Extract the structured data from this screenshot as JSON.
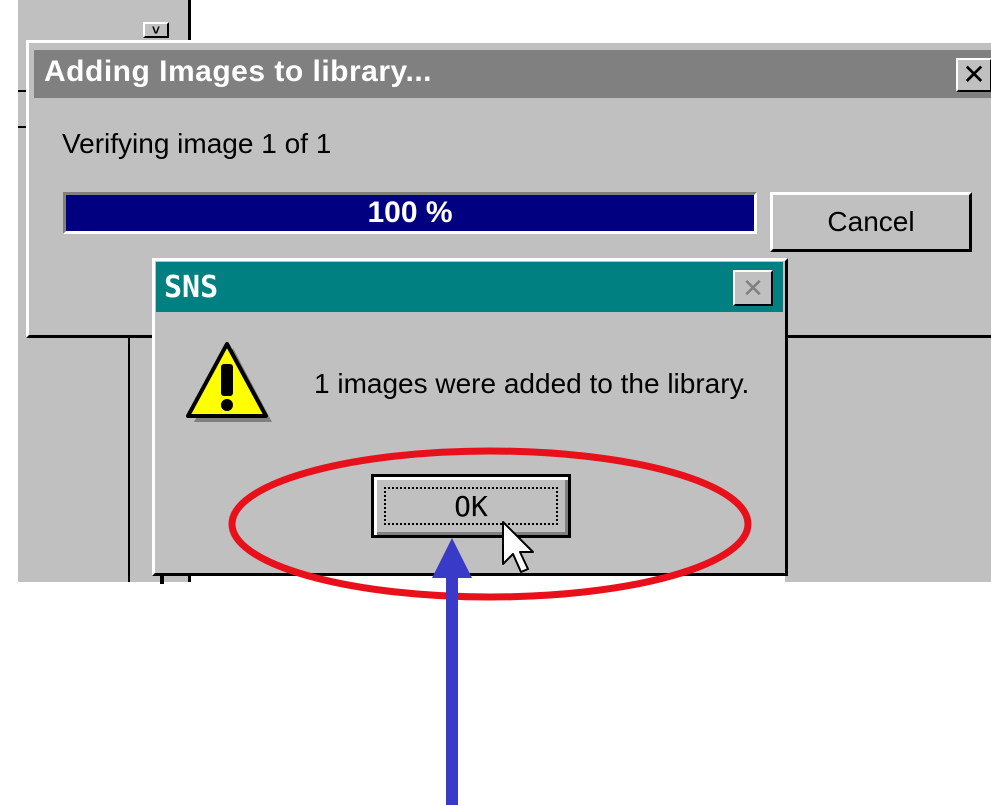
{
  "background_app": {
    "dropdown_icon": "chevron-down-icon"
  },
  "progress_dialog": {
    "title": "Adding Images to library...",
    "close_label": "✕",
    "status": "Verifying image 1 of 1",
    "progress_percent": 100,
    "progress_label": "100 %",
    "cancel_label": "Cancel",
    "colors": {
      "titlebar": "#808080",
      "bar": "#000080"
    }
  },
  "message_box": {
    "title": "SNS",
    "close_label": "✕",
    "icon": "warning-icon",
    "message": "1 images were added to the library.",
    "ok_label": "OK",
    "colors": {
      "titlebar": "#008080"
    }
  },
  "annotations": {
    "highlight_color": "#e8101a",
    "arrow_color": "#3a3ac8",
    "cursor_icon": "mouse-pointer-icon"
  }
}
